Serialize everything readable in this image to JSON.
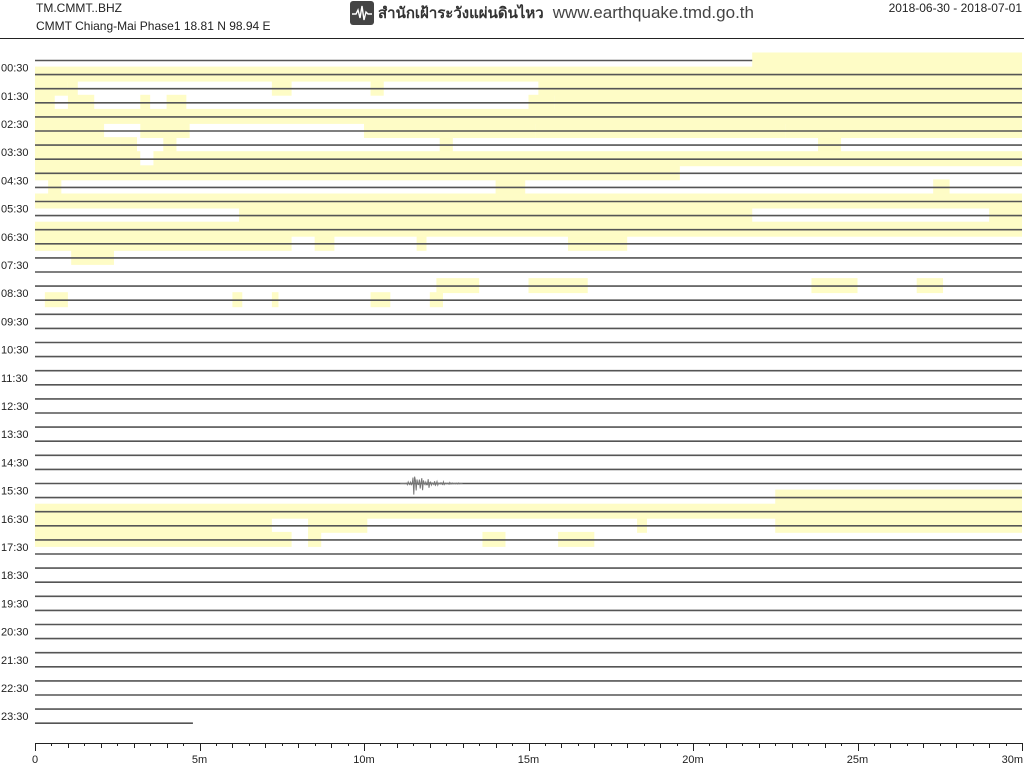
{
  "header": {
    "station_code": "TM.CMMT..BHZ",
    "station_description": "CMMT Chiang-Mai Phase1  18.81 N 98.94 E",
    "agency_name": "สำนักเฝ้าระวังแผ่นดินไหว",
    "agency_url": "www.earthquake.tmd.go.th",
    "date_range": "2018-06-30 - 2018-07-01",
    "logo_icon": "seismograph-icon"
  },
  "colors": {
    "noise_band": "#fefcc6",
    "trace": "#555555",
    "event": "#777777",
    "axis": "#222222"
  },
  "chart_data": {
    "type": "line",
    "title": "",
    "xlabel": "",
    "ylabel": "",
    "xlim": [
      0,
      30
    ],
    "x_ticks": [
      0,
      5,
      10,
      15,
      20,
      25,
      30
    ],
    "x_tick_labels": [
      "0",
      "5m",
      "10m",
      "15m",
      "20m",
      "25m",
      "30m"
    ],
    "y_tick_labels": [
      "00:30",
      "01:30",
      "02:30",
      "03:30",
      "04:30",
      "05:30",
      "06:30",
      "07:30",
      "08:30",
      "09:30",
      "10:30",
      "11:30",
      "12:30",
      "13:30",
      "14:30",
      "15:30",
      "16:30",
      "17:30",
      "18:30",
      "19:30",
      "20:30",
      "21:30",
      "22:30",
      "23:30"
    ],
    "row_start_times": [
      "00:00",
      "00:30",
      "01:00",
      "01:30",
      "02:00",
      "02:30",
      "03:00",
      "03:30",
      "04:00",
      "04:30",
      "05:00",
      "05:30",
      "06:00",
      "06:30",
      "07:00",
      "07:30",
      "08:00",
      "08:30",
      "09:00",
      "09:30",
      "10:00",
      "10:30",
      "11:00",
      "11:30",
      "12:00",
      "12:30",
      "13:00",
      "13:30",
      "14:00",
      "14:30",
      "15:00",
      "15:30",
      "16:00",
      "16:30",
      "17:00",
      "17:30",
      "18:00",
      "18:30",
      "19:00",
      "19:30",
      "20:00",
      "20:30",
      "21:00",
      "21:30",
      "22:00",
      "22:30",
      "23:00",
      "23:30"
    ],
    "rows_per_label": 2,
    "row_end_minutes": {
      "0": 21.8,
      "47": 4.8
    },
    "noise_segments": [
      {
        "row": 0,
        "start": 21.8,
        "end": 30
      },
      {
        "row": 1,
        "start": 0,
        "end": 30
      },
      {
        "row": 2,
        "start": 0,
        "end": 1.0
      },
      {
        "row": 2,
        "start": 1.0,
        "end": 1.3
      },
      {
        "row": 2,
        "start": 7.2,
        "end": 7.8
      },
      {
        "row": 2,
        "start": 10.2,
        "end": 10.6
      },
      {
        "row": 2,
        "start": 15.3,
        "end": 30
      },
      {
        "row": 3,
        "start": 0,
        "end": 0.6
      },
      {
        "row": 3,
        "start": 1.0,
        "end": 1.8
      },
      {
        "row": 3,
        "start": 3.2,
        "end": 3.5
      },
      {
        "row": 3,
        "start": 4.0,
        "end": 4.6
      },
      {
        "row": 3,
        "start": 15.0,
        "end": 15.8
      },
      {
        "row": 3,
        "start": 15.8,
        "end": 30
      },
      {
        "row": 4,
        "start": 0,
        "end": 30
      },
      {
        "row": 5,
        "start": 0,
        "end": 2.1
      },
      {
        "row": 5,
        "start": 3.2,
        "end": 4.7
      },
      {
        "row": 5,
        "start": 10.0,
        "end": 15.2
      },
      {
        "row": 5,
        "start": 15.2,
        "end": 22.8
      },
      {
        "row": 5,
        "start": 22.8,
        "end": 30
      },
      {
        "row": 6,
        "start": 0,
        "end": 2.6
      },
      {
        "row": 6,
        "start": 2.6,
        "end": 3.1
      },
      {
        "row": 6,
        "start": 3.9,
        "end": 4.3
      },
      {
        "row": 6,
        "start": 12.3,
        "end": 12.7
      },
      {
        "row": 6,
        "start": 23.8,
        "end": 24.5
      },
      {
        "row": 7,
        "start": 0,
        "end": 3.2
      },
      {
        "row": 7,
        "start": 3.6,
        "end": 30
      },
      {
        "row": 8,
        "start": 0,
        "end": 19.6
      },
      {
        "row": 9,
        "start": 0.4,
        "end": 0.8
      },
      {
        "row": 9,
        "start": 14.0,
        "end": 14.9
      },
      {
        "row": 9,
        "start": 27.3,
        "end": 27.8
      },
      {
        "row": 10,
        "start": 0,
        "end": 30
      },
      {
        "row": 11,
        "start": 6.2,
        "end": 21.8
      },
      {
        "row": 11,
        "start": 29.0,
        "end": 30
      },
      {
        "row": 12,
        "start": 0,
        "end": 30
      },
      {
        "row": 13,
        "start": 0,
        "end": 7.8
      },
      {
        "row": 13,
        "start": 8.5,
        "end": 9.1
      },
      {
        "row": 13,
        "start": 11.6,
        "end": 11.9
      },
      {
        "row": 13,
        "start": 16.2,
        "end": 18.0
      },
      {
        "row": 14,
        "start": 1.1,
        "end": 2.4
      },
      {
        "row": 16,
        "start": 12.2,
        "end": 13.5
      },
      {
        "row": 16,
        "start": 15.0,
        "end": 16.8
      },
      {
        "row": 16,
        "start": 23.6,
        "end": 25.0
      },
      {
        "row": 16,
        "start": 26.8,
        "end": 27.6
      },
      {
        "row": 17,
        "start": 0.3,
        "end": 1.0
      },
      {
        "row": 17,
        "start": 6.0,
        "end": 6.3
      },
      {
        "row": 17,
        "start": 7.2,
        "end": 7.4
      },
      {
        "row": 17,
        "start": 10.2,
        "end": 10.8
      },
      {
        "row": 17,
        "start": 12.0,
        "end": 12.4
      },
      {
        "row": 31,
        "start": 22.5,
        "end": 30
      },
      {
        "row": 32,
        "start": 0,
        "end": 30
      },
      {
        "row": 33,
        "start": 0,
        "end": 7.2
      },
      {
        "row": 33,
        "start": 8.3,
        "end": 10.1
      },
      {
        "row": 33,
        "start": 18.3,
        "end": 18.6
      },
      {
        "row": 33,
        "start": 22.5,
        "end": 30
      },
      {
        "row": 34,
        "start": 0,
        "end": 7.8
      },
      {
        "row": 34,
        "start": 8.3,
        "end": 8.7
      },
      {
        "row": 34,
        "start": 13.6,
        "end": 14.3
      },
      {
        "row": 34,
        "start": 15.9,
        "end": 17.0
      }
    ],
    "events": [
      {
        "row": 30,
        "start": 11.1,
        "end": 13.0,
        "peak_minute": 11.55
      }
    ]
  }
}
